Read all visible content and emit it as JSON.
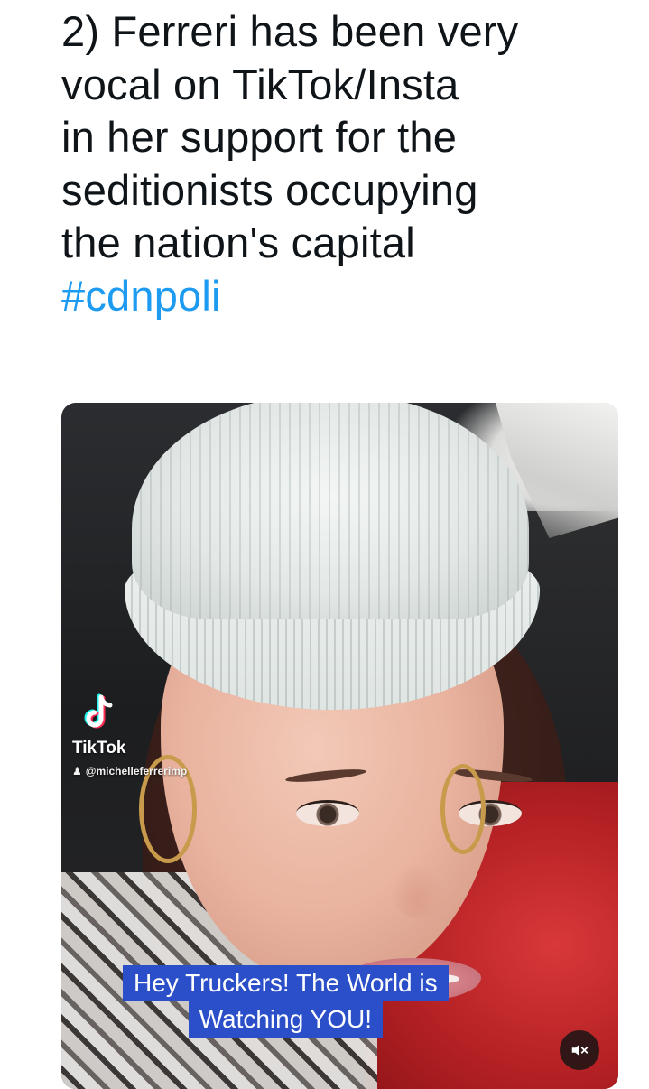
{
  "tweet": {
    "lines": [
      "2) Ferreri has been very",
      "vocal on TikTok/Insta",
      "in her support for the",
      "seditionists occupying",
      "the nation's capital"
    ],
    "hashtag": "#cdnpoli"
  },
  "media": {
    "watermark": {
      "brand": "TikTok",
      "handle": "@michelleferrerimp"
    },
    "caption": {
      "line1": "Hey Truckers! The World is",
      "line2": "Watching YOU!"
    },
    "mute_icon": "speaker-muted-icon"
  },
  "colors": {
    "hashtag": "#1d9bf0",
    "caption_bg": "#2b4fc9",
    "text": "#0f1419"
  }
}
